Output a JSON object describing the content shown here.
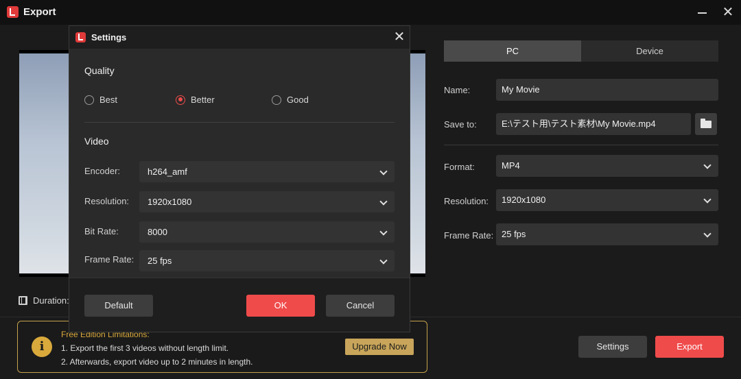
{
  "window": {
    "title": "Export"
  },
  "preview": {
    "duration_label": "Duration:"
  },
  "tabs": [
    {
      "label": "PC"
    },
    {
      "label": "Device"
    }
  ],
  "export_form": {
    "name_label": "Name:",
    "name_value": "My Movie",
    "save_label": "Save to:",
    "save_value": "E:\\テスト用\\テスト素材\\My Movie.mp4",
    "format_label": "Format:",
    "format_value": "MP4",
    "resolution_label": "Resolution:",
    "resolution_value": "1920x1080",
    "framerate_label": "Frame Rate:",
    "framerate_value": "25 fps"
  },
  "limitations": {
    "title": "Free Edition Limitations:",
    "line1": "1. Export the first 3 videos without length limit.",
    "line2": "2. Afterwards, export video up to 2 minutes in length.",
    "upgrade_label": "Upgrade Now"
  },
  "bottom_buttons": {
    "settings_label": "Settings",
    "export_label": "Export"
  },
  "settings_dialog": {
    "title": "Settings",
    "quality_title": "Quality",
    "quality_options": [
      "Best",
      "Better",
      "Good"
    ],
    "quality_selected": "Better",
    "video_title": "Video",
    "encoder_label": "Encoder:",
    "encoder_value": "h264_amf",
    "resolution_label": "Resolution:",
    "resolution_value": "1920x1080",
    "bitrate_label": "Bit Rate:",
    "bitrate_value": "8000",
    "framerate_label": "Frame Rate:",
    "framerate_value": "25 fps",
    "default_label": "Default",
    "ok_label": "OK",
    "cancel_label": "Cancel"
  },
  "colors": {
    "accent": "#f04b4b",
    "warning": "#d9a93c"
  }
}
